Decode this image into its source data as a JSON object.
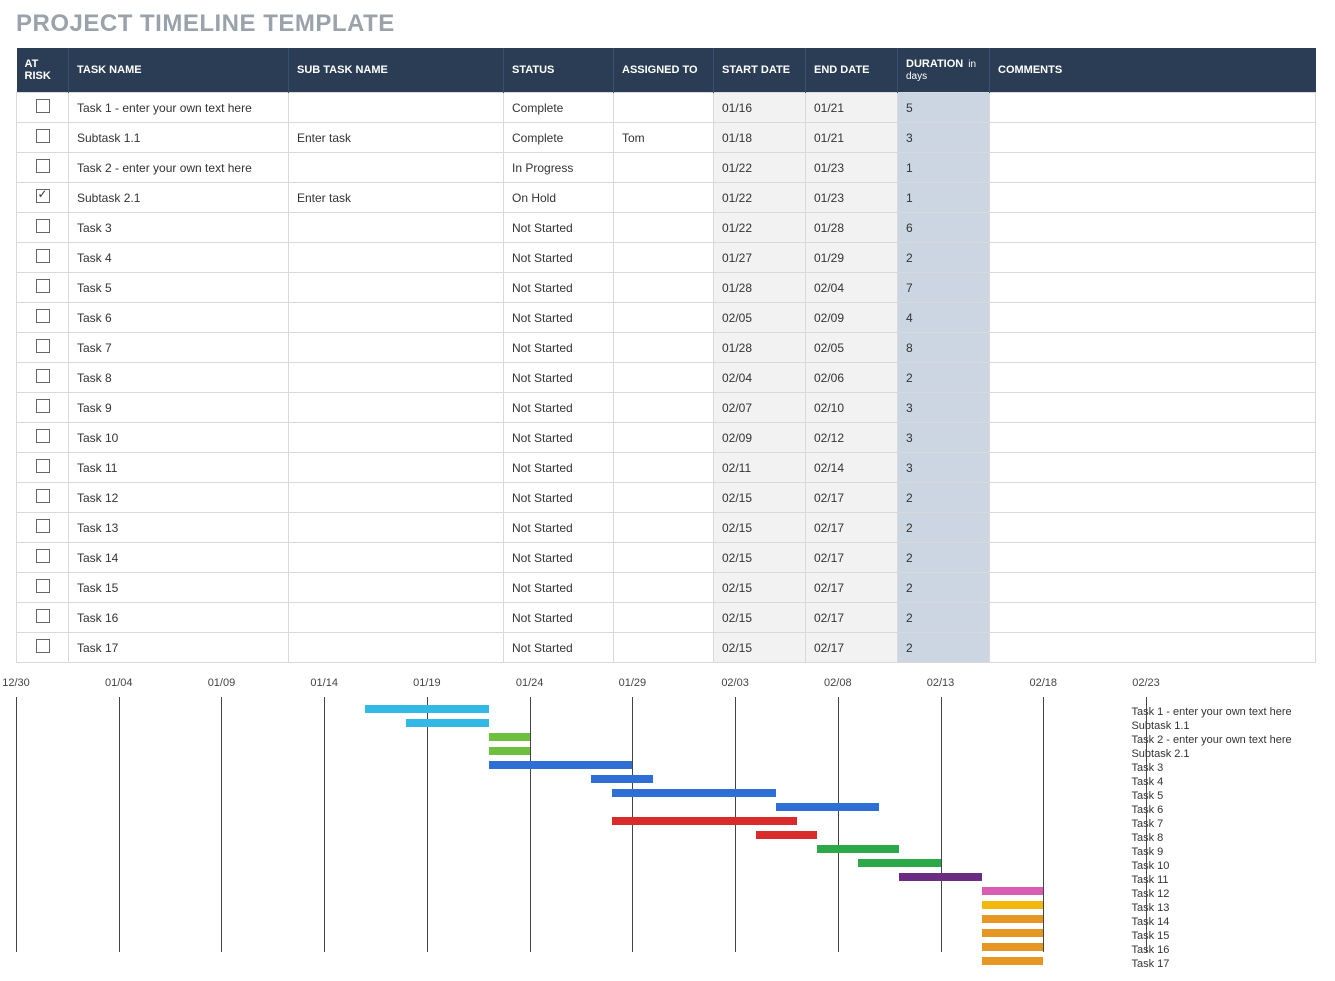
{
  "title": "PROJECT TIMELINE TEMPLATE",
  "columns": {
    "risk": "AT RISK",
    "task": "TASK NAME",
    "subtask": "SUB TASK NAME",
    "status": "STATUS",
    "assigned": "ASSIGNED TO",
    "start": "START DATE",
    "end": "END DATE",
    "duration": "DURATION",
    "duration_unit": "in days",
    "comments": "COMMENTS"
  },
  "rows": [
    {
      "risk": false,
      "task": "Task 1 - enter your own text here",
      "subtask": "",
      "status": "Complete",
      "assigned": "",
      "start": "01/16",
      "end": "01/21",
      "duration": "5",
      "comments": ""
    },
    {
      "risk": false,
      "task": "Subtask 1.1",
      "subtask": "Enter task",
      "status": "Complete",
      "assigned": "Tom",
      "start": "01/18",
      "end": "01/21",
      "duration": "3",
      "comments": ""
    },
    {
      "risk": false,
      "task": "Task 2 - enter your own text here",
      "subtask": "",
      "status": "In Progress",
      "assigned": "",
      "start": "01/22",
      "end": "01/23",
      "duration": "1",
      "comments": ""
    },
    {
      "risk": true,
      "task": "Subtask 2.1",
      "subtask": "Enter task",
      "status": "On Hold",
      "assigned": "",
      "start": "01/22",
      "end": "01/23",
      "duration": "1",
      "comments": ""
    },
    {
      "risk": false,
      "task": "Task 3",
      "subtask": "",
      "status": "Not Started",
      "assigned": "",
      "start": "01/22",
      "end": "01/28",
      "duration": "6",
      "comments": ""
    },
    {
      "risk": false,
      "task": "Task 4",
      "subtask": "",
      "status": "Not Started",
      "assigned": "",
      "start": "01/27",
      "end": "01/29",
      "duration": "2",
      "comments": ""
    },
    {
      "risk": false,
      "task": "Task 5",
      "subtask": "",
      "status": "Not Started",
      "assigned": "",
      "start": "01/28",
      "end": "02/04",
      "duration": "7",
      "comments": ""
    },
    {
      "risk": false,
      "task": "Task 6",
      "subtask": "",
      "status": "Not Started",
      "assigned": "",
      "start": "02/05",
      "end": "02/09",
      "duration": "4",
      "comments": ""
    },
    {
      "risk": false,
      "task": "Task 7",
      "subtask": "",
      "status": "Not Started",
      "assigned": "",
      "start": "01/28",
      "end": "02/05",
      "duration": "8",
      "comments": ""
    },
    {
      "risk": false,
      "task": "Task 8",
      "subtask": "",
      "status": "Not Started",
      "assigned": "",
      "start": "02/04",
      "end": "02/06",
      "duration": "2",
      "comments": ""
    },
    {
      "risk": false,
      "task": "Task 9",
      "subtask": "",
      "status": "Not Started",
      "assigned": "",
      "start": "02/07",
      "end": "02/10",
      "duration": "3",
      "comments": ""
    },
    {
      "risk": false,
      "task": "Task 10",
      "subtask": "",
      "status": "Not Started",
      "assigned": "",
      "start": "02/09",
      "end": "02/12",
      "duration": "3",
      "comments": ""
    },
    {
      "risk": false,
      "task": "Task 11",
      "subtask": "",
      "status": "Not Started",
      "assigned": "",
      "start": "02/11",
      "end": "02/14",
      "duration": "3",
      "comments": ""
    },
    {
      "risk": false,
      "task": "Task 12",
      "subtask": "",
      "status": "Not Started",
      "assigned": "",
      "start": "02/15",
      "end": "02/17",
      "duration": "2",
      "comments": ""
    },
    {
      "risk": false,
      "task": "Task 13",
      "subtask": "",
      "status": "Not Started",
      "assigned": "",
      "start": "02/15",
      "end": "02/17",
      "duration": "2",
      "comments": ""
    },
    {
      "risk": false,
      "task": "Task 14",
      "subtask": "",
      "status": "Not Started",
      "assigned": "",
      "start": "02/15",
      "end": "02/17",
      "duration": "2",
      "comments": ""
    },
    {
      "risk": false,
      "task": "Task 15",
      "subtask": "",
      "status": "Not Started",
      "assigned": "",
      "start": "02/15",
      "end": "02/17",
      "duration": "2",
      "comments": ""
    },
    {
      "risk": false,
      "task": "Task 16",
      "subtask": "",
      "status": "Not Started",
      "assigned": "",
      "start": "02/15",
      "end": "02/17",
      "duration": "2",
      "comments": ""
    },
    {
      "risk": false,
      "task": "Task 17",
      "subtask": "",
      "status": "Not Started",
      "assigned": "",
      "start": "02/15",
      "end": "02/17",
      "duration": "2",
      "comments": ""
    }
  ],
  "chart_data": {
    "type": "bar",
    "title": "",
    "xlabel": "",
    "ylabel": "",
    "x_axis": {
      "min": "12/30",
      "max": "02/23",
      "ticks": [
        "12/30",
        "01/04",
        "01/09",
        "01/14",
        "01/19",
        "01/24",
        "01/29",
        "02/03",
        "02/08",
        "02/13",
        "02/18",
        "02/23"
      ]
    },
    "series": [
      {
        "name": "Task 1 - enter your own text here",
        "start": "01/16",
        "end": "01/21",
        "color": "#33b9e6"
      },
      {
        "name": "Subtask 1.1",
        "start": "01/18",
        "end": "01/21",
        "color": "#33b9e6"
      },
      {
        "name": "Task 2 - enter your own text here",
        "start": "01/22",
        "end": "01/23",
        "color": "#6fbf3f"
      },
      {
        "name": "Subtask 2.1",
        "start": "01/22",
        "end": "01/23",
        "color": "#6fbf3f"
      },
      {
        "name": "Task 3",
        "start": "01/22",
        "end": "01/28",
        "color": "#2e6fd6"
      },
      {
        "name": "Task 4",
        "start": "01/27",
        "end": "01/29",
        "color": "#2e6fd6"
      },
      {
        "name": "Task 5",
        "start": "01/28",
        "end": "02/04",
        "color": "#2e6fd6"
      },
      {
        "name": "Task 6",
        "start": "02/05",
        "end": "02/09",
        "color": "#2e6fd6"
      },
      {
        "name": "Task 7",
        "start": "01/28",
        "end": "02/05",
        "color": "#d92b2b"
      },
      {
        "name": "Task 8",
        "start": "02/04",
        "end": "02/06",
        "color": "#d92b2b"
      },
      {
        "name": "Task 9",
        "start": "02/07",
        "end": "02/10",
        "color": "#2ba84a"
      },
      {
        "name": "Task 10",
        "start": "02/09",
        "end": "02/12",
        "color": "#2ba84a"
      },
      {
        "name": "Task 11",
        "start": "02/11",
        "end": "02/14",
        "color": "#6a2d82"
      },
      {
        "name": "Task 12",
        "start": "02/15",
        "end": "02/17",
        "color": "#d95db3"
      },
      {
        "name": "Task 13",
        "start": "02/15",
        "end": "02/17",
        "color": "#f2b90c"
      },
      {
        "name": "Task 14",
        "start": "02/15",
        "end": "02/17",
        "color": "#e69623"
      },
      {
        "name": "Task 15",
        "start": "02/15",
        "end": "02/17",
        "color": "#e69623"
      },
      {
        "name": "Task 16",
        "start": "02/15",
        "end": "02/17",
        "color": "#e69623"
      },
      {
        "name": "Task 17",
        "start": "02/15",
        "end": "02/17",
        "color": "#e69623"
      }
    ]
  }
}
